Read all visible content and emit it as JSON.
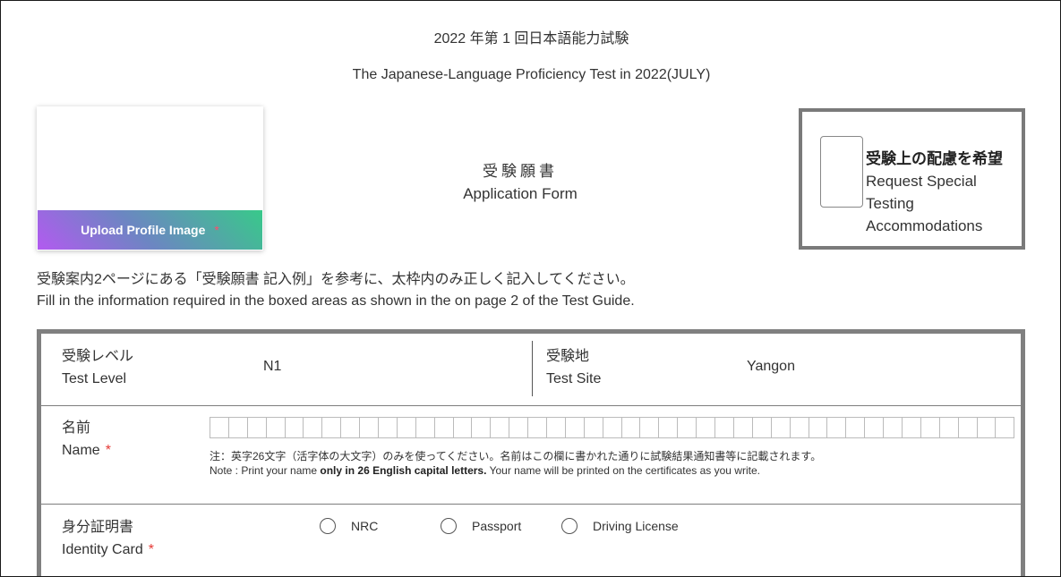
{
  "header": {
    "title_jp": "2022 年第 1 回日本語能力試験",
    "title_en": "The Japanese-Language Proficiency Test in 2022(JULY)"
  },
  "photo": {
    "upload_label": "Upload Profile Image",
    "required_mark": "*"
  },
  "form_title": {
    "jp": "受験願書",
    "en": "Application Form"
  },
  "accommodations": {
    "jp": "受験上の配慮を希望",
    "en_line1": "Request Special",
    "en_line2": "Testing",
    "en_line3": "Accommodations",
    "checked": false
  },
  "instructions": {
    "jp": "受験案内2ページにある「受験願書 記入例」を参考に、太枠内のみ正しく記入してください。",
    "en": "Fill in the information required in the boxed areas as shown in the on page 2 of the Test Guide."
  },
  "table": {
    "test_level": {
      "label_jp": "受験レベル",
      "label_en": "Test Level",
      "value": "N1"
    },
    "test_site": {
      "label_jp": "受験地",
      "label_en": "Test Site",
      "value": "Yangon"
    },
    "name": {
      "label_jp": "名前",
      "label_en": "Name",
      "required_mark": "*",
      "note_jp": "注：英字26文字（活字体の大文字）のみを使ってください。名前はこの欄に書かれた通りに試験結果通知書等に記載されます。",
      "note_en_prefix": "Note : Print your name ",
      "note_en_bold": "only in 26 English capital letters.",
      "note_en_suffix": " Your name will be printed on the certificates as you write."
    },
    "identity": {
      "label_jp": "身分証明書",
      "label_en": "Identity Card",
      "required_mark": "*",
      "options": [
        "NRC",
        "Passport",
        "Driving License"
      ],
      "selected": null
    }
  }
}
